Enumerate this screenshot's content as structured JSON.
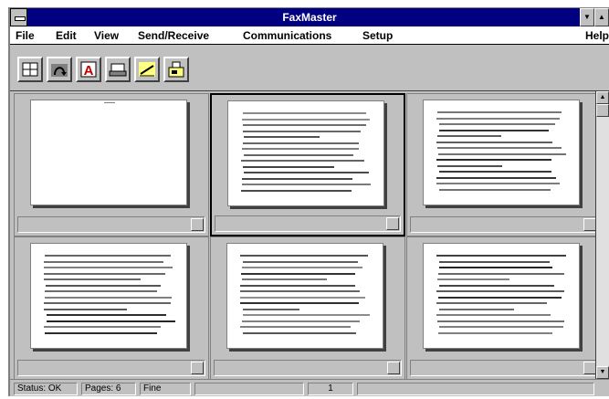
{
  "window": {
    "title": "FaxMaster"
  },
  "menu": [
    "File",
    "Edit",
    "View",
    "Send/Receive",
    "Communications",
    "Setup",
    "Help"
  ],
  "toolbar": {
    "buttons": [
      {
        "icon": "grid-view-icon"
      },
      {
        "icon": "rotate-page-icon"
      },
      {
        "icon": "annotate-text-icon"
      },
      {
        "icon": "scanner-icon"
      },
      {
        "icon": "signature-pen-icon"
      },
      {
        "icon": "fax-machine-icon"
      }
    ]
  },
  "pages": [
    {
      "blank": true,
      "active": false
    },
    {
      "blank": false,
      "active": true
    },
    {
      "blank": false,
      "active": false
    },
    {
      "blank": false,
      "active": false
    },
    {
      "blank": false,
      "active": false
    },
    {
      "blank": false,
      "active": false
    }
  ],
  "status": {
    "status_label": "Status: OK",
    "pages_label": "Pages: 6",
    "fine_label": "Fine",
    "page_indicator": "1"
  },
  "colors": {
    "titlebar": "#000080",
    "window": "#c0c0c0"
  }
}
